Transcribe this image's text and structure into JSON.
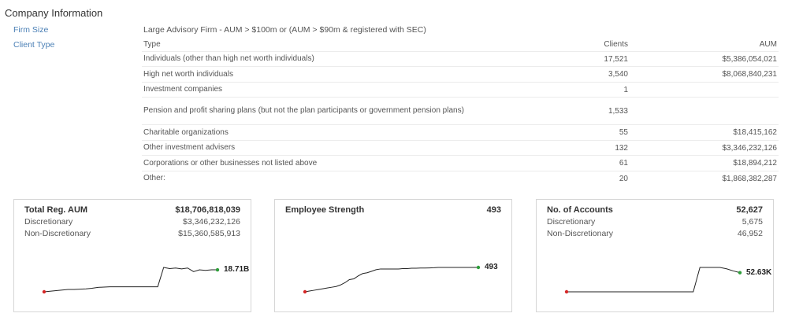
{
  "section_title": "Company Information",
  "firm_size": {
    "label": "Firm Size",
    "value": "Large Advisory Firm - AUM > $100m or (AUM > $90m & registered with SEC)"
  },
  "client_type": {
    "label": "Client Type",
    "headers": {
      "type": "Type",
      "clients": "Clients",
      "aum": "AUM"
    },
    "rows": [
      {
        "type": "Individuals (other than high net worth individuals)",
        "clients": "17,521",
        "aum": "$5,386,054,021"
      },
      {
        "type": "High net worth individuals",
        "clients": "3,540",
        "aum": "$8,068,840,231"
      },
      {
        "type": "Investment companies",
        "clients": "1",
        "aum": ""
      },
      {
        "type": "Pension and profit sharing plans (but not the plan participants or government pension plans)",
        "clients": "1,533",
        "aum": ""
      },
      {
        "type": "Charitable organizations",
        "clients": "55",
        "aum": "$18,415,162"
      },
      {
        "type": "Other investment advisers",
        "clients": "132",
        "aum": "$3,346,232,126"
      },
      {
        "type": "Corporations or other businesses not listed above",
        "clients": "61",
        "aum": "$18,894,212"
      },
      {
        "type": "Other:",
        "clients": "20",
        "aum": "$1,868,382,287"
      }
    ]
  },
  "cards": [
    {
      "title": "Total Reg. AUM",
      "value": "$18,706,818,039",
      "sub": [
        {
          "label": "Discretionary",
          "value": "$3,346,232,126"
        },
        {
          "label": "Non-Discretionary",
          "value": "$15,360,585,913"
        }
      ],
      "spark_label": "18.71B",
      "spark": [
        0.18,
        0.2,
        0.22,
        0.24,
        0.26,
        0.26,
        0.27,
        0.28,
        0.3,
        0.33,
        0.34,
        0.35,
        0.35,
        0.35,
        0.35,
        0.35,
        0.35,
        0.35,
        0.35,
        0.35,
        1.0,
        0.96,
        0.98,
        0.95,
        0.98,
        0.86,
        0.92,
        0.9,
        0.92,
        0.92
      ]
    },
    {
      "title": "Employee Strength",
      "value": "493",
      "sub": [],
      "spark_label": "493",
      "spark": [
        0.0,
        0.05,
        0.1,
        0.15,
        0.2,
        0.25,
        0.3,
        0.35,
        0.45,
        0.6,
        0.8,
        0.85,
        1.05,
        1.2,
        1.25,
        1.35,
        1.45,
        1.5,
        1.5,
        1.5,
        1.5,
        1.5,
        1.52,
        1.52,
        1.55,
        1.55,
        1.56,
        1.56,
        1.57,
        1.58,
        1.6,
        1.6,
        1.6,
        1.6,
        1.6,
        1.6,
        1.6,
        1.6,
        1.6,
        1.6
      ]
    },
    {
      "title": "No. of Accounts",
      "value": "52,627",
      "sub": [
        {
          "label": "Discretionary",
          "value": "5,675"
        },
        {
          "label": "Non-Discretionary",
          "value": "46,952"
        }
      ],
      "spark_label": "52.63K",
      "spark": [
        0.3,
        0.3,
        0.3,
        0.3,
        0.3,
        0.3,
        0.3,
        0.3,
        0.3,
        0.3,
        0.3,
        0.3,
        0.3,
        0.3,
        0.3,
        0.3,
        0.3,
        0.3,
        0.3,
        0.3,
        1.0,
        1.0,
        1.0,
        1.0,
        0.96,
        0.9,
        0.85
      ]
    }
  ],
  "colors": {
    "start_dot": "#d62828",
    "end_dot": "#2e9e3a",
    "line": "#222222",
    "link": "#4a7fb5"
  }
}
